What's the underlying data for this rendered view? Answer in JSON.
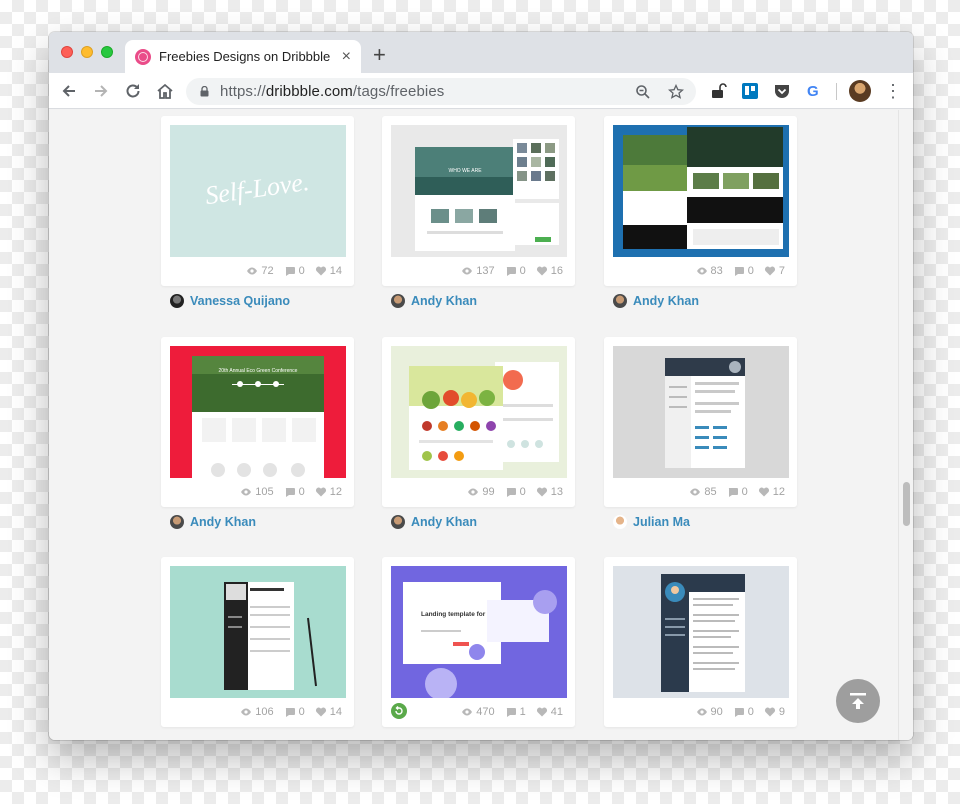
{
  "browser": {
    "tab_title": "Freebies Designs on Dribbble",
    "tab_close": "×",
    "new_tab": "+",
    "url_prefix": "https://",
    "url_host": "dribbble.com",
    "url_path": "/tags/freebies",
    "menu": "⋮"
  },
  "shots": [
    {
      "views": "72",
      "comments": "0",
      "likes": "14",
      "author": "Vanessa Quijano",
      "thumb_text": "Self-Love."
    },
    {
      "views": "137",
      "comments": "0",
      "likes": "16",
      "author": "Andy Khan",
      "thumb_text": "WHO WE ARE"
    },
    {
      "views": "83",
      "comments": "0",
      "likes": "7",
      "author": "Andy Khan"
    },
    {
      "views": "105",
      "comments": "0",
      "likes": "12",
      "author": "Andy Khan",
      "thumb_text": "20th Annual Eco Green Conference"
    },
    {
      "views": "99",
      "comments": "0",
      "likes": "13",
      "author": "Andy Khan"
    },
    {
      "views": "85",
      "comments": "0",
      "likes": "12",
      "author": "Julian Ma"
    },
    {
      "views": "106",
      "comments": "0",
      "likes": "14",
      "author": ""
    },
    {
      "views": "470",
      "comments": "1",
      "likes": "41",
      "author": "",
      "thumb_text": "Landing template for startups"
    },
    {
      "views": "90",
      "comments": "0",
      "likes": "9",
      "author": ""
    }
  ],
  "colors": {
    "accent_link": "#3a8bbb",
    "dribbble_pink": "#ea4c89",
    "stat_gray": "#a3a3a3"
  }
}
